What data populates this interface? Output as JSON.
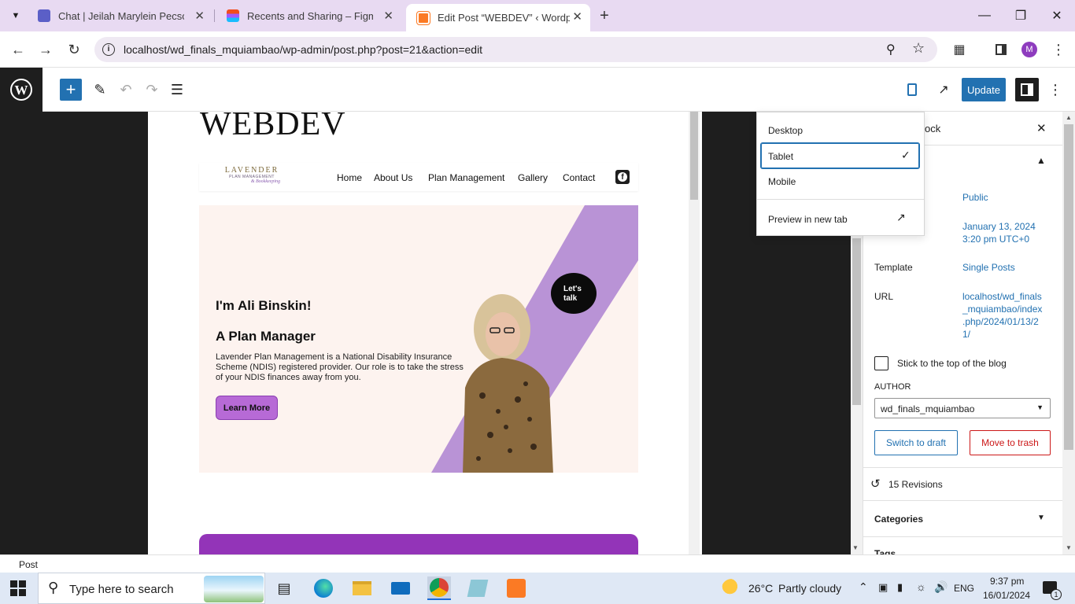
{
  "browser": {
    "tabs": [
      {
        "title": "Chat | Jeilah Marylein Pecson | M",
        "icon": "teams-icon"
      },
      {
        "title": "Recents and Sharing – Figma",
        "icon": "figma-icon"
      },
      {
        "title": "Edit Post “WEBDEV” ‹ Wordpress",
        "icon": "xampp-icon"
      }
    ],
    "url": "localhost/wd_finals_mquiambao/wp-admin/post.php?post=21&action=edit",
    "profile_initial": "M"
  },
  "editor": {
    "update_label": "Update"
  },
  "site": {
    "title": "WEBDEV",
    "logo_line1": "LAVENDER",
    "logo_line2": "PLAN MANAGEMENT",
    "logo_line3": "& Bookkeeping",
    "nav": [
      "Home",
      "About Us",
      "Plan Management",
      "Gallery",
      "Contact"
    ],
    "hero": {
      "greeting": "I'm Ali Binskin!",
      "role": "A Plan Manager",
      "body": "Lavender Plan Management is a National Disability Insurance Scheme (NDIS) registered provider. Our role is to take the stress of your NDIS finances away from you.",
      "cta": "Learn More",
      "bubble": "Let's talk"
    }
  },
  "preview_menu": {
    "items": [
      "Desktop",
      "Tablet",
      "Mobile"
    ],
    "selected": "Tablet",
    "preview_new_tab": "Preview in new tab"
  },
  "sidebar": {
    "header_partial": "ock",
    "visibility_value": "Public",
    "publish_date": "January 13, 2024",
    "publish_time": "3:20 pm UTC+0",
    "template_label": "Template",
    "template_value": "Single Posts",
    "url_label": "URL",
    "url_lines": [
      "localhost/wd_finals",
      "_mquiambao/index",
      ".php/2024/01/13/2",
      "1/"
    ],
    "sticky_label": "Stick to the top of the blog",
    "author_label": "AUTHOR",
    "author_value": "wd_finals_mquiambao",
    "switch_draft": "Switch to draft",
    "move_trash": "Move to trash",
    "revisions": "15 Revisions",
    "categories": "Categories",
    "tags_partial": "Tags"
  },
  "status_bar": {
    "label": "Post"
  },
  "taskbar": {
    "search_placeholder": "Type here to search",
    "weather_temp": "26°C",
    "weather_text": "Partly cloudy",
    "language": "ENG",
    "time": "9:37 pm",
    "date": "16/01/2024",
    "notification_count": "1"
  },
  "colors": {
    "wp_blue": "#2271b1",
    "trash_red": "#cc1818",
    "hero_purple": "#b993d6",
    "cta_purple": "#b76ad6"
  }
}
